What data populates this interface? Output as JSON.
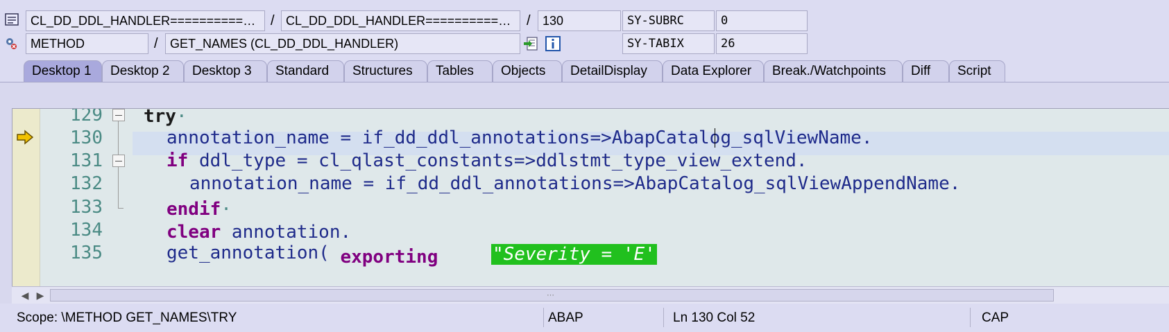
{
  "header": {
    "row1": {
      "program": "CL_DD_DDL_HANDLER============...",
      "include": "CL_DD_DDL_HANDLER============...",
      "line": "130",
      "sysvar_label": "SY-SUBRC",
      "sysvar_value": "0",
      "sep1": "/",
      "sep2": "/"
    },
    "row2": {
      "type": "METHOD",
      "name": "GET_NAMES (CL_DD_DDL_HANDLER)",
      "sysvar_label": "SY-TABIX",
      "sysvar_value": "26",
      "sep": "/"
    },
    "icons": [
      "program-icon",
      "method-icon",
      "navigate-icon",
      "info-icon"
    ]
  },
  "tabs": [
    {
      "label": "Desktop 1",
      "active": true
    },
    {
      "label": "Desktop 2",
      "active": false
    },
    {
      "label": "Desktop 3",
      "active": false
    },
    {
      "label": "Standard",
      "active": false
    },
    {
      "label": "Structures",
      "active": false
    },
    {
      "label": "Tables",
      "active": false
    },
    {
      "label": "Objects",
      "active": false
    },
    {
      "label": "DetailDisplay",
      "active": false
    },
    {
      "label": "Data Explorer",
      "active": false
    },
    {
      "label": "Break./Watchpoints",
      "active": false
    },
    {
      "label": "Diff",
      "active": false
    },
    {
      "label": "Script",
      "active": false
    }
  ],
  "editor": {
    "line_numbers": [
      "129",
      "130",
      "131",
      "132",
      "133",
      "134",
      "135"
    ],
    "current_line": "130",
    "code": {
      "l129_kw": "try",
      "l130": "annotation_name = if_dd_ddl_annotations=>AbapCatalog_sqlViewName.",
      "l131_kw": "if",
      "l131_rest": " ddl_type = cl_qlast_constants=>ddlstmt_type_view_extend.",
      "l132": "annotation_name = if_dd_ddl_annotations=>AbapCatalog_sqlViewAppendName.",
      "l133_kw": "endif",
      "l134_kw": "clear",
      "l134_rest": " annotation.",
      "l135_a": "get_annotation(",
      "l135_kw": "exporting",
      "l135_comment": "\"Severity = 'E'"
    }
  },
  "statusbar": {
    "scope": "Scope: \\METHOD GET_NAMES\\TRY",
    "language": "ABAP",
    "position": "Ln 130 Col  52",
    "caps": "CAP"
  },
  "colors": {
    "keyword": "#800080",
    "identifier": "#1e2a8a",
    "line_number": "#4a8a84",
    "comment_bg": "#21c01e",
    "current_line_bg": "#d4dff0",
    "active_tab": "#a9a9dd"
  }
}
